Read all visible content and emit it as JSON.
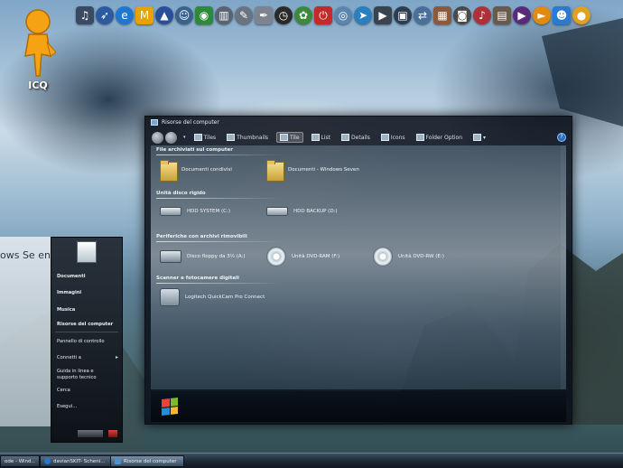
{
  "desktop": {
    "icq_label": "ICQ"
  },
  "launchbar": {
    "icons": [
      {
        "name": "headphones-icon",
        "color": "#3a4a62",
        "glyph": "♫"
      },
      {
        "name": "rocket-icon",
        "color": "#2c5aa0",
        "glyph": "➶"
      },
      {
        "name": "internet-explorer-icon",
        "color": "#1e78d2",
        "glyph": "e"
      },
      {
        "name": "media-icon",
        "color": "#e6a200",
        "glyph": "M"
      },
      {
        "name": "wizard-icon",
        "color": "#2a4e9a",
        "glyph": "▲"
      },
      {
        "name": "user-icon",
        "color": "#39628e",
        "glyph": "☺"
      },
      {
        "name": "globe-icon",
        "color": "#2c8a3a",
        "glyph": "◉"
      },
      {
        "name": "books-icon",
        "color": "#5a6470",
        "glyph": "▥"
      },
      {
        "name": "tools-icon",
        "color": "#6a7480",
        "glyph": "✎"
      },
      {
        "name": "pen-icon",
        "color": "#7b8490",
        "glyph": "✒"
      },
      {
        "name": "clock-icon",
        "color": "#2a2a2a",
        "glyph": "◷"
      },
      {
        "name": "wheel-icon",
        "color": "#3a8a3a",
        "glyph": "✿"
      },
      {
        "name": "power-icon",
        "color": "#c42a2a",
        "glyph": "⏻"
      },
      {
        "name": "network-icon",
        "color": "#5a86b0",
        "glyph": "◎"
      },
      {
        "name": "flag-icon",
        "color": "#2a7fbf",
        "glyph": "➤"
      },
      {
        "name": "video-icon",
        "color": "#3a4450",
        "glyph": "▶"
      },
      {
        "name": "monitor-icon",
        "color": "#2c3e50",
        "glyph": "▣"
      },
      {
        "name": "network-share-icon",
        "color": "#4a6f9a",
        "glyph": "⇄"
      },
      {
        "name": "picture-icon",
        "color": "#8a5a3a",
        "glyph": "▦"
      },
      {
        "name": "camera-icon",
        "color": "#4a4a4a",
        "glyph": "◙"
      },
      {
        "name": "music-icon",
        "color": "#b0303a",
        "glyph": "♪"
      },
      {
        "name": "photo-icon",
        "color": "#6a5a4a",
        "glyph": "▤"
      },
      {
        "name": "movie-icon",
        "color": "#5a2a7a",
        "glyph": "▶"
      },
      {
        "name": "play-icon",
        "color": "#e08a10",
        "glyph": "►"
      },
      {
        "name": "messenger-icon",
        "color": "#2a7ad2",
        "glyph": "☻"
      },
      {
        "name": "extra-icon",
        "color": "#e0a020",
        "glyph": "●"
      }
    ]
  },
  "explorer": {
    "title": "Risorse del computer",
    "toolbar": {
      "tiles_label": "Tiles",
      "thumbnails_label": "Thumbnails",
      "tile_label": "Tile",
      "list_label": "List",
      "details_label": "Details",
      "icons_label": "Icons",
      "folder_options_label": "Folder Option"
    },
    "groups": [
      {
        "header": "File archiviati sul computer",
        "items": [
          "Documenti condivisi",
          "Documenti - Windows Seven"
        ]
      },
      {
        "header": "Unità disco rigido",
        "items": [
          "HDD SYSTEM (C:)",
          "HDD BACKUP (D:)"
        ]
      },
      {
        "header": "Periferiche con archivi rimovibili",
        "items": [
          "Disco floppy da 3½ (A:)",
          "Unità DVD-RAM (F:)",
          "Unità DVD-RW (E:)"
        ]
      },
      {
        "header": "Scanner e fotocamere digitali",
        "items": [
          "Logitech QuickCam Pro Connect"
        ]
      }
    ]
  },
  "startmenu": {
    "brand": "ows Se en",
    "user_tile": "user",
    "items": [
      {
        "label": "Documenti",
        "bold": true
      },
      {
        "label": "Immagini",
        "bold": true
      },
      {
        "label": "Musica",
        "bold": true
      },
      {
        "label": "Risorse del computer",
        "bold": true
      },
      {
        "label": "Pannello di controllo",
        "bold": false
      },
      {
        "label": "Connetti a",
        "bold": false
      },
      {
        "label": "Guida in linea e supporto tecnico",
        "bold": false
      },
      {
        "label": "Cerca",
        "bold": false
      },
      {
        "label": "Esegui...",
        "bold": false
      }
    ]
  },
  "taskbar": {
    "buttons": [
      {
        "label": "ode - Wind...",
        "color": "#e85a10"
      },
      {
        "label": "davianSKIT- Scheni...",
        "color": "#1f7ad6"
      },
      {
        "label": "Risorse del computer",
        "color": "#4f8fd0"
      }
    ]
  },
  "colors": {
    "window_bg": "#08101a",
    "taskbar": "#1f2a36",
    "accent": "#4f8fd0"
  }
}
